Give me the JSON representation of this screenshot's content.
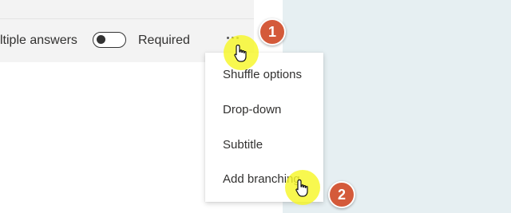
{
  "toolbar": {
    "multiple_answers_label": "ltiple answers",
    "required_label": "Required",
    "required_toggle_state": "off",
    "more_options_icon": "more-options-icon"
  },
  "menu": {
    "items": [
      {
        "label": "Shuffle options"
      },
      {
        "label": "Drop-down"
      },
      {
        "label": "Subtitle"
      },
      {
        "label": "Add branching"
      }
    ]
  },
  "annotations": {
    "steps": [
      {
        "number": "1",
        "color": "#d45a3a"
      },
      {
        "number": "2",
        "color": "#d45a3a"
      }
    ],
    "highlight_color": "#f6f628"
  },
  "colors": {
    "toolbar_background": "#f3f3f3",
    "right_area_background": "#e6eff2",
    "text": "#323130"
  }
}
